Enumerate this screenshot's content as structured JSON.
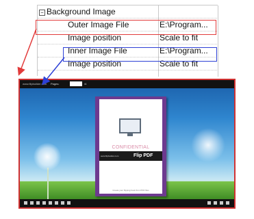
{
  "properties": {
    "group_label": "Background Image",
    "expander_symbol": "⊟",
    "rows": [
      {
        "name": "Outer Image File",
        "value": "E:\\Program..."
      },
      {
        "name": "Image position",
        "value": "Scale to fit"
      },
      {
        "name": "Inner Image File",
        "value": "E:\\Program..."
      },
      {
        "name": "Image position",
        "value": "Scale to fit"
      }
    ]
  },
  "preview": {
    "site_text": "www.flipbuilder.com",
    "pages_label": "Pages:",
    "pages_total": "/4",
    "book": {
      "confidential": "CONFIDENTIAL",
      "url_text": "www.flipbuilder.com",
      "flip_pdf": "Flip PDF",
      "footnote": "Create your flipping book from PDF files"
    }
  },
  "colors": {
    "outer_highlight": "#e23b3b",
    "inner_highlight": "#2d40d6",
    "book_border": "#6d3a8f"
  }
}
